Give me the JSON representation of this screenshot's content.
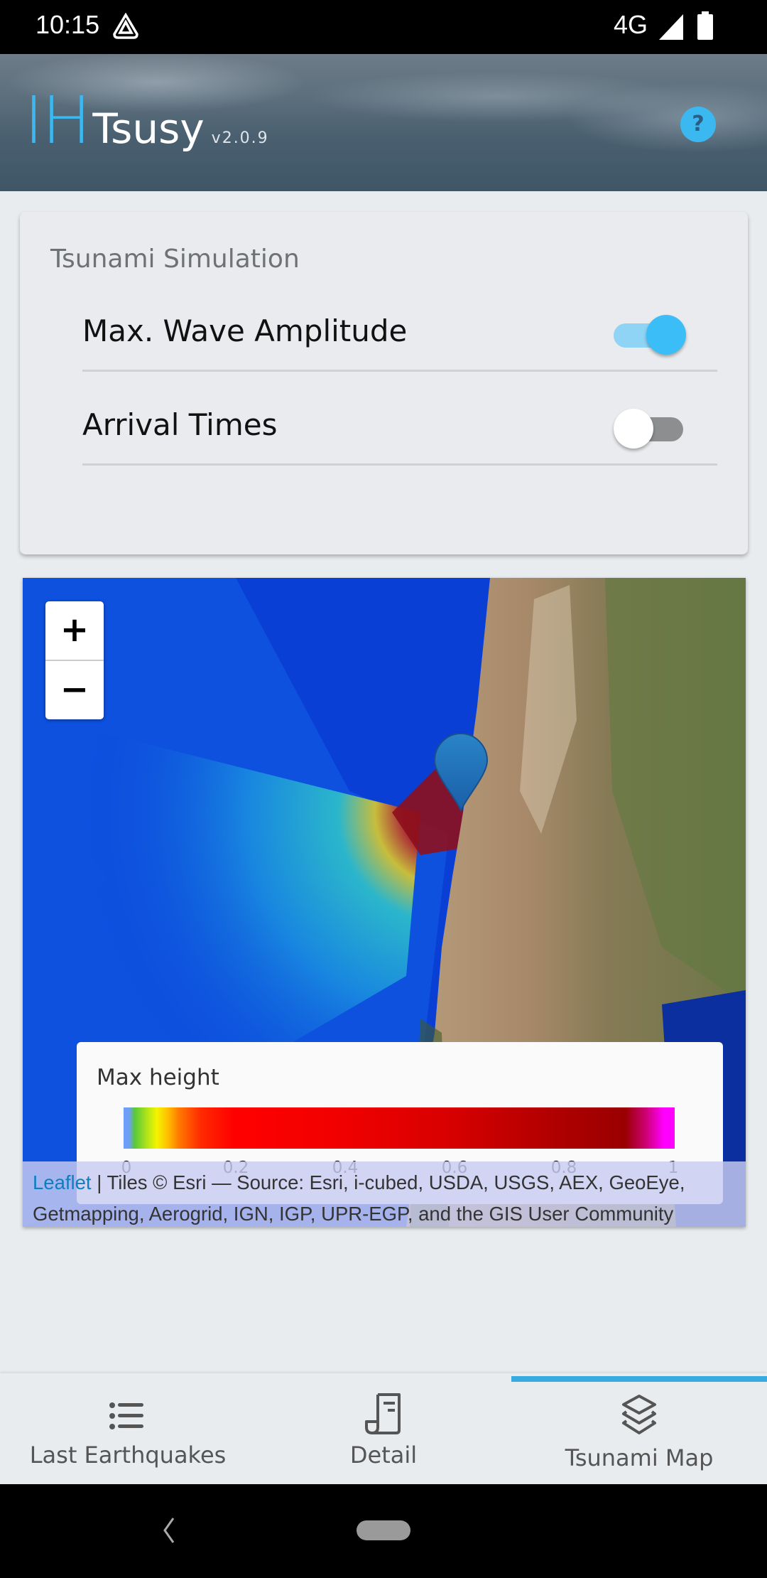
{
  "status_bar": {
    "time": "10:15",
    "network": "4G",
    "icons": [
      "notification-icon",
      "signal-icon",
      "battery-icon"
    ]
  },
  "header": {
    "logo_prefix": "IH",
    "app_name": "Tsusy",
    "version": "v2.0.9",
    "help_label": "?",
    "accent_color": "#3bb8f0"
  },
  "simulation_card": {
    "title": "Tsunami Simulation",
    "options": [
      {
        "label": "Max. Wave Amplitude",
        "enabled": true
      },
      {
        "label": "Arrival Times",
        "enabled": false
      }
    ]
  },
  "map": {
    "zoom_in_label": "+",
    "zoom_out_label": "−",
    "marker": "epicenter-marker",
    "legend": {
      "title": "Max height",
      "ticks": [
        "0",
        "0.2",
        "0.4",
        "0.6",
        "0.8",
        "1"
      ],
      "range": [
        0,
        1
      ]
    },
    "attribution": {
      "link_label": "Leaflet",
      "text": " | Tiles © Esri — Source: Esri, i-cubed, USDA, USGS, AEX, GeoEye, Getmapping, Aerogrid, IGN, IGP, UPR-EGP, and the GIS User Community"
    }
  },
  "tab_bar": {
    "active_index": 2,
    "active_color": "#37aae0",
    "tabs": [
      {
        "label": "Last Earthquakes",
        "icon": "list-icon"
      },
      {
        "label": "Detail",
        "icon": "receipt-icon"
      },
      {
        "label": "Tsunami Map",
        "icon": "layers-icon"
      }
    ]
  }
}
